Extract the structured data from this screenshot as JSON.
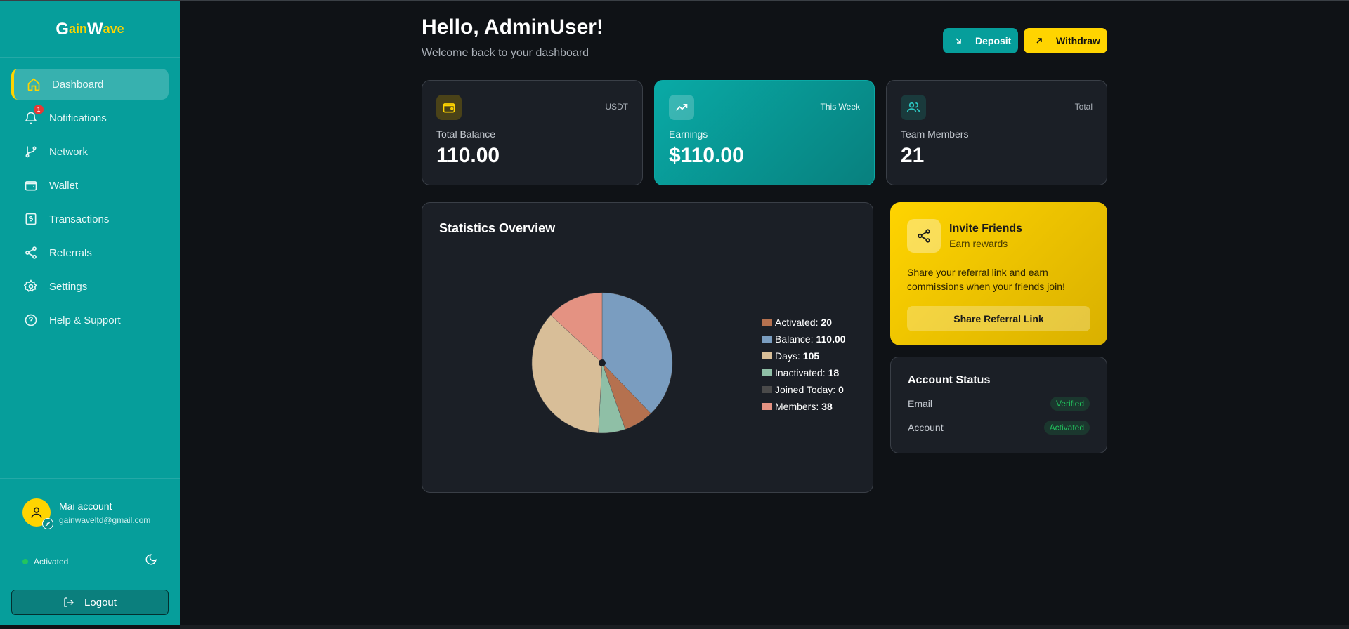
{
  "brand": {
    "g": "G",
    "ain": "ain",
    "w": "W",
    "ave": "ave"
  },
  "sidebar": {
    "items": [
      {
        "label": "Dashboard",
        "icon": "home-icon"
      },
      {
        "label": "Notifications",
        "icon": "bell-icon",
        "badge": "1"
      },
      {
        "label": "Network",
        "icon": "git-branch-icon"
      },
      {
        "label": "Wallet",
        "icon": "wallet-icon"
      },
      {
        "label": "Transactions",
        "icon": "dollar-receipt-icon"
      },
      {
        "label": "Referrals",
        "icon": "share-icon"
      },
      {
        "label": "Settings",
        "icon": "gear-icon"
      },
      {
        "label": "Help & Support",
        "icon": "help-circle-icon"
      }
    ],
    "account": {
      "name": "Mai account",
      "email": "gainwaveltd@gmail.com"
    },
    "status": "Activated",
    "logout": "Logout"
  },
  "header": {
    "greeting": "Hello, AdminUser!",
    "subtitle": "Welcome back to your dashboard",
    "deposit": "Deposit",
    "withdraw": "Withdraw"
  },
  "cards": [
    {
      "tag": "USDT",
      "label": "Total Balance",
      "value": "110.00",
      "icon": "wallet-icon"
    },
    {
      "tag": "This Week",
      "label": "Earnings",
      "value": "$110.00",
      "icon": "trending-up-icon"
    },
    {
      "tag": "Total",
      "label": "Team Members",
      "value": "21",
      "icon": "users-icon"
    }
  ],
  "stats": {
    "title": "Statistics Overview"
  },
  "chart_data": {
    "type": "pie",
    "categories": [
      "Activated",
      "Balance",
      "Days",
      "Inactivated",
      "Joined Today",
      "Members"
    ],
    "values": [
      20,
      110.0,
      105,
      18,
      0,
      38
    ],
    "labels": [
      "20",
      "110.00",
      "105",
      "18",
      "0",
      "38"
    ],
    "colors": [
      "#b5714f",
      "#7a9dc0",
      "#d8be98",
      "#8fbfa6",
      "#4a4a4a",
      "#e49282"
    ],
    "legend": "right"
  },
  "invite": {
    "title": "Invite Friends",
    "subtitle": "Earn rewards",
    "text": "Share your referral link and earn commissions when your friends join!",
    "button": "Share Referral Link"
  },
  "account_status": {
    "title": "Account Status",
    "rows": [
      {
        "label": "Email",
        "value": "Verified"
      },
      {
        "label": "Account",
        "value": "Activated"
      }
    ]
  },
  "colors": {
    "teal": "#069e9b",
    "yellow": "#ffd400",
    "bg": "#0f1216",
    "card": "#1b1f26"
  }
}
